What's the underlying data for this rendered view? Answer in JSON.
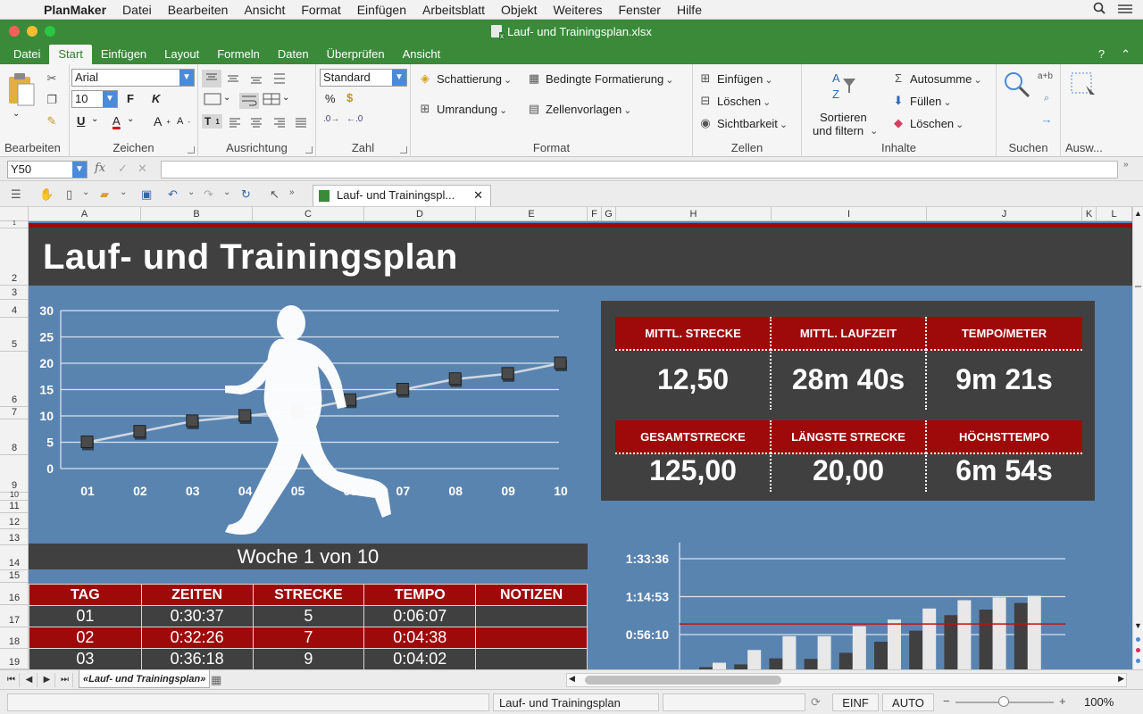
{
  "menubar": {
    "app": "PlanMaker",
    "items": [
      "Datei",
      "Bearbeiten",
      "Ansicht",
      "Format",
      "Einfügen",
      "Arbeitsblatt",
      "Objekt",
      "Weiteres",
      "Fenster",
      "Hilfe"
    ]
  },
  "window": {
    "title": "Lauf- und Trainingsplan.xlsx"
  },
  "ribbon": {
    "tabs": [
      "Datei",
      "Start",
      "Einfügen",
      "Layout",
      "Formeln",
      "Daten",
      "Überprüfen",
      "Ansicht"
    ],
    "active_tab": "Start",
    "help": "?",
    "groups": {
      "bearbeiten": "Bearbeiten",
      "zeichen": "Zeichen",
      "ausrichtung": "Ausrichtung",
      "zahl": "Zahl",
      "format": "Format",
      "zellen": "Zellen",
      "inhalte": "Inhalte",
      "suchen": "Suchen",
      "auswahl": "Ausw..."
    },
    "font_name": "Arial",
    "font_size": "10",
    "bold": "F",
    "italic": "K",
    "underline": "U",
    "font_color": "A",
    "grow": "A",
    "shrink": "A",
    "number_format": "Standard",
    "percent": "%",
    "schattierung": "Schattierung",
    "bedingte": "Bedingte Formatierung",
    "umrandung": "Umrandung",
    "zellenvorlagen": "Zellenvorlagen",
    "einfuegen": "Einfügen",
    "loeschen": "Löschen",
    "sichtbarkeit": "Sichtbarkeit",
    "sortieren1": "Sortieren",
    "sortieren2": "und filtern",
    "autosumme": "Autosumme",
    "fuellen": "Füllen",
    "loeschen2": "Löschen",
    "replace": "a+b"
  },
  "formula_bar": {
    "cell_ref": "Y50",
    "fx": "fx",
    "value": ""
  },
  "doc_tab": {
    "label": "Lauf- und Trainingspl..."
  },
  "columns": [
    "A",
    "B",
    "C",
    "D",
    "E",
    "F",
    "G",
    "H",
    "I",
    "J",
    "K",
    "L"
  ],
  "rows": [
    "1",
    "2",
    "3",
    "4",
    "5",
    "6",
    "7",
    "8",
    "9",
    "10",
    "11",
    "12",
    "13",
    "14",
    "15",
    "16",
    "17",
    "18",
    "19"
  ],
  "sheet": {
    "title": "Lauf- und Trainingsplan",
    "woche": "Woche 1 von 10",
    "table": {
      "headers": [
        "TAG",
        "ZEITEN",
        "STRECKE",
        "TEMPO",
        "NOTIZEN"
      ],
      "rows": [
        [
          "01",
          "0:30:37",
          "5",
          "0:06:07",
          ""
        ],
        [
          "02",
          "0:32:26",
          "7",
          "0:04:38",
          ""
        ],
        [
          "03",
          "0:36:18",
          "9",
          "0:04:02",
          ""
        ]
      ]
    },
    "stats": {
      "mittl_strecke_label": "MITTL. STRECKE",
      "mittl_strecke": "12,50",
      "mittl_laufzeit_label": "MITTL. LAUFZEIT",
      "mittl_laufzeit": "28m 40s",
      "tempo_meter_label": "TEMPO/METER",
      "tempo_meter": "9m 21s",
      "gesamt_label": "GESAMTSTRECKE",
      "gesamt": "125,00",
      "laengste_label": "LÄNGSTE STRECKE",
      "laengste": "20,00",
      "hoechst_label": "HÖCHSTTEMPO",
      "hoechst": "6m 54s"
    }
  },
  "chart_data": [
    {
      "type": "line",
      "x": [
        "01",
        "02",
        "03",
        "04",
        "05",
        "06",
        "07",
        "08",
        "09",
        "10"
      ],
      "series": [
        {
          "values": [
            5,
            7,
            9,
            10,
            11,
            13,
            15,
            17,
            18,
            20
          ]
        }
      ],
      "yticks": [
        "0",
        "5",
        "10",
        "15",
        "20",
        "25",
        "30"
      ],
      "ylim": [
        0,
        30
      ],
      "grid": true
    },
    {
      "type": "bar",
      "yticks": [
        "1:33:36",
        "1:14:53",
        "0:56:10"
      ],
      "series": [
        {
          "values": [
            0.04,
            0.09,
            0.2,
            0.19,
            0.3,
            0.5,
            0.7,
            0.98,
            1.08,
            1.2
          ]
        },
        {
          "values": [
            0.12,
            0.35,
            0.6,
            0.6,
            0.78,
            0.9,
            1.1,
            1.25,
            1.3,
            1.33
          ]
        }
      ],
      "target_line": 0.82,
      "colors": {
        "dark": "#404040",
        "light": "#e8e8e8",
        "line": "#c01010"
      }
    }
  ],
  "sheet_tab": "«Lauf- und Trainingsplan»",
  "status": {
    "sheet_name": "Lauf- und Trainingsplan",
    "mode1": "EINF",
    "mode2": "AUTO",
    "zoom": "100%"
  },
  "colors": {
    "accent_green": "#3a8a3a",
    "sheet_blue": "#5a84b0",
    "dark_gray": "#404040",
    "red": "#9e0a0a"
  }
}
